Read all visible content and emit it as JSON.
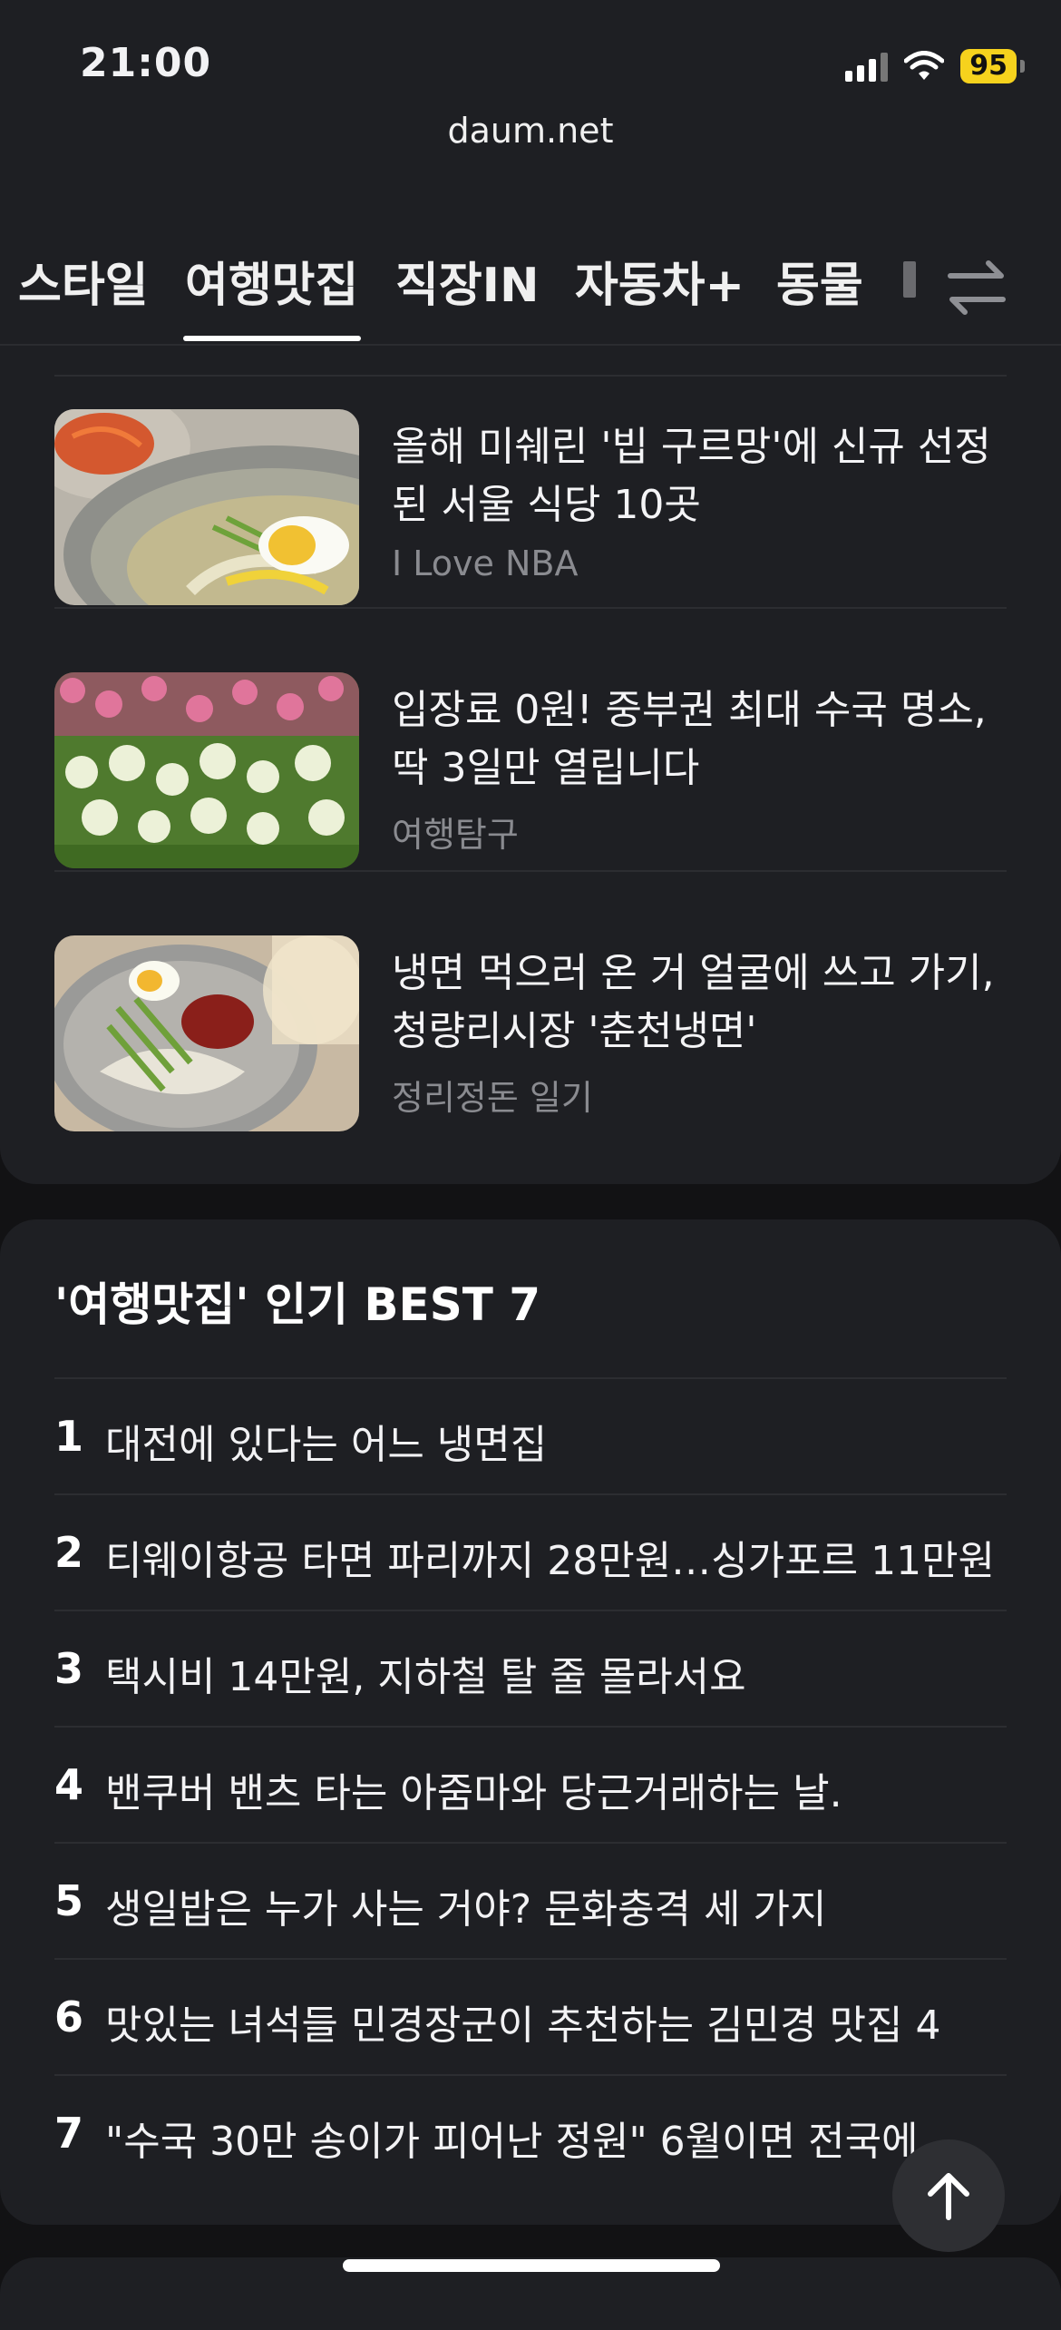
{
  "status_bar": {
    "time": "21:00",
    "battery": "95"
  },
  "browser": {
    "url": "daum.net"
  },
  "tabs": [
    {
      "label": "스타일"
    },
    {
      "label": "여행맛집",
      "active": true
    },
    {
      "label": "직장IN"
    },
    {
      "label": "자동차+"
    },
    {
      "label": "동물"
    }
  ],
  "articles": [
    {
      "title": "올해 미쉐린 '빕 구르망'에 신규 선정된 서울 식당 10곳",
      "source": "I Love NBA",
      "image": "naengmyeon-bowl-photo"
    },
    {
      "title": "입장료 0원! 중부권 최대 수국 명소, 딱 3일만 열립니다",
      "source": "여행탐구",
      "image": "hydrangea-garden-photo"
    },
    {
      "title": "냉면 먹으러 온 거 얼굴에 쓰고 가기, 청량리시장 '춘천냉면'",
      "source": "정리정돈 일기",
      "image": "bibim-naengmyeon-photo"
    }
  ],
  "best": {
    "title": "'여행맛집' 인기 BEST 7",
    "items": [
      {
        "rank": "1",
        "text": "대전에 있다는 어느 냉면집"
      },
      {
        "rank": "2",
        "text": "티웨이항공 타면 파리까지 28만원…싱가포르 11만원"
      },
      {
        "rank": "3",
        "text": "택시비 14만원, 지하철 탈 줄 몰라서요"
      },
      {
        "rank": "4",
        "text": "밴쿠버 밴츠 타는 아줌마와 당근거래하는 날."
      },
      {
        "rank": "5",
        "text": "생일밥은 누가 사는 거야? 문화충격 세 가지"
      },
      {
        "rank": "6",
        "text": "맛있는 녀석들 민경장군이 추천하는 김민경 맛집 4"
      },
      {
        "rank": "7",
        "text": "\"수국 30만 송이가 피어난 정원\" 6월이면 전국에"
      }
    ]
  },
  "icons": {
    "signal": "cellular-signal-icon",
    "wifi": "wifi-icon",
    "swap": "swap-arrows-icon",
    "scroll_top": "arrow-up-icon"
  },
  "colors": {
    "background": "#121214",
    "card": "#1e1f23",
    "battery": "#f6d21d",
    "muted_text": "#8a8b90"
  }
}
